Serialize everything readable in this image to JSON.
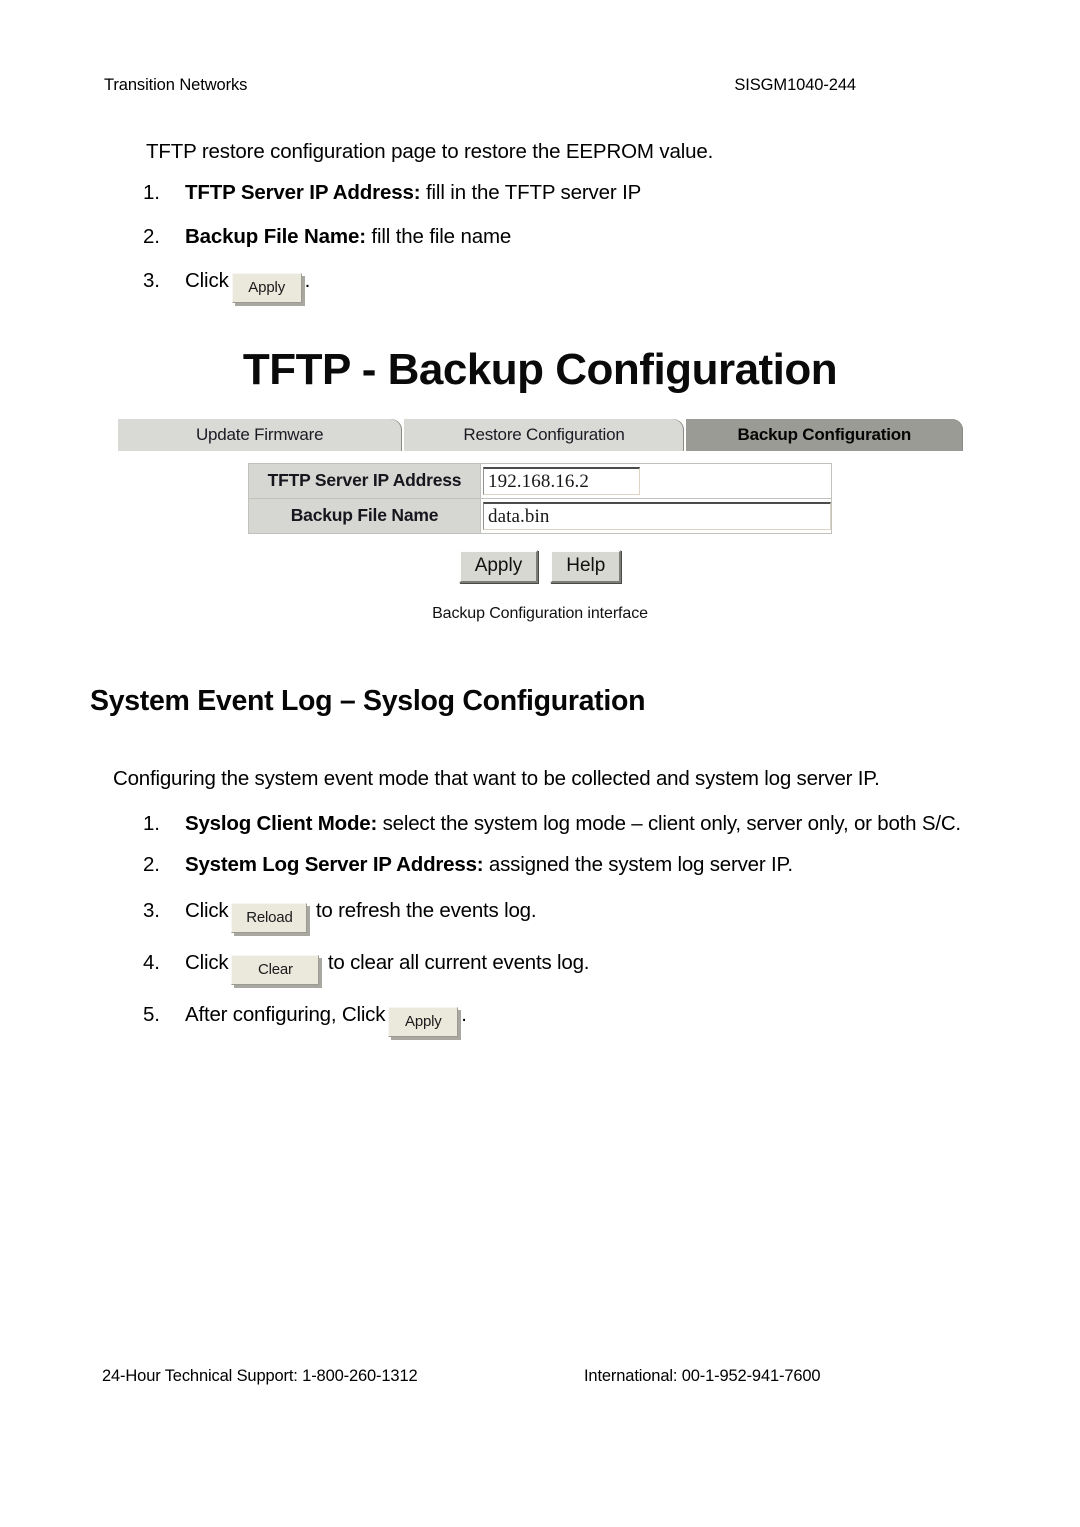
{
  "header": {
    "left": "Transition Networks",
    "right": "SISGM1040-244"
  },
  "intro": {
    "paragraph": "TFTP restore configuration page to restore the EEPROM value."
  },
  "backup_steps": [
    {
      "num": "1.",
      "bold": "TFTP Server IP Address:",
      "rest": " fill in the TFTP server IP"
    },
    {
      "num": "2.",
      "bold": "Backup File Name:",
      "rest": " fill the file name"
    },
    {
      "num": "3.",
      "before": "Click",
      "button": "Apply",
      "after": "."
    }
  ],
  "figure": {
    "title": "TFTP - Backup Configuration",
    "tabs": [
      {
        "label": "Update Firmware",
        "active": false
      },
      {
        "label": "Restore Configuration",
        "active": false
      },
      {
        "label": "Backup Configuration",
        "active": true
      }
    ],
    "form": {
      "rows": [
        {
          "label": "TFTP Server IP Address",
          "value": "192.168.16.2"
        },
        {
          "label": "Backup File Name",
          "value": "data.bin"
        }
      ],
      "buttons": [
        "Apply",
        "Help"
      ]
    },
    "caption": "Backup Configuration interface"
  },
  "syslog_section": {
    "heading": "System Event Log – Syslog Configuration",
    "paragraph": "Configuring the system event mode that want to be collected and system log server IP.",
    "steps": [
      {
        "num": "1.",
        "bold": "Syslog Client Mode:",
        "rest": " select the system log mode – client only, server only, or both S/C."
      },
      {
        "num": "2.",
        "bold": "System Log Server IP Address:",
        "rest": " assigned the system log server IP."
      },
      {
        "num": "3.",
        "before": "Click",
        "button": "Reload",
        "after": "to refresh the events log."
      },
      {
        "num": "4.",
        "before": "Click",
        "button": "Clear",
        "after": "to clear all current events log."
      },
      {
        "num": "5.",
        "before": "After configuring, Click",
        "button": "Apply",
        "after": "."
      }
    ]
  },
  "footer": {
    "left": "24-Hour Technical Support: 1-800-260-1312",
    "right": "International: 00-1-952-941-7600"
  }
}
